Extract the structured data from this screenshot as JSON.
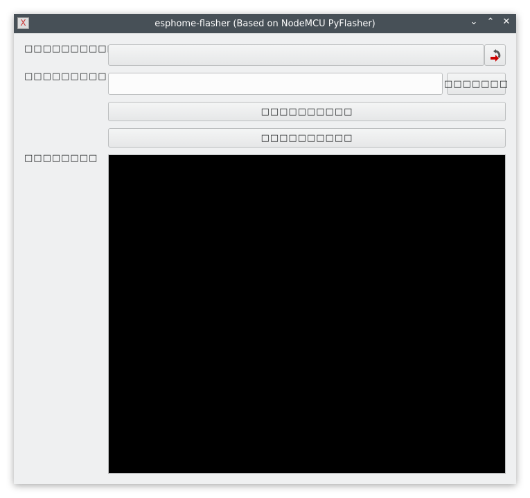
{
  "window": {
    "title": "esphome-flasher (Based on NodeMCU PyFlasher)"
  },
  "labels": {
    "serial_port": "□□□□□□□□□□□□",
    "firmware": "□□□□□□□□□",
    "console": "□□□□□□□□"
  },
  "buttons": {
    "browse": "□□□□□□□",
    "flash": "□□□□□□□□□□",
    "view_logs": "□□□□□□□□□□"
  },
  "serial_port": {
    "value": ""
  },
  "firmware": {
    "value": ""
  }
}
